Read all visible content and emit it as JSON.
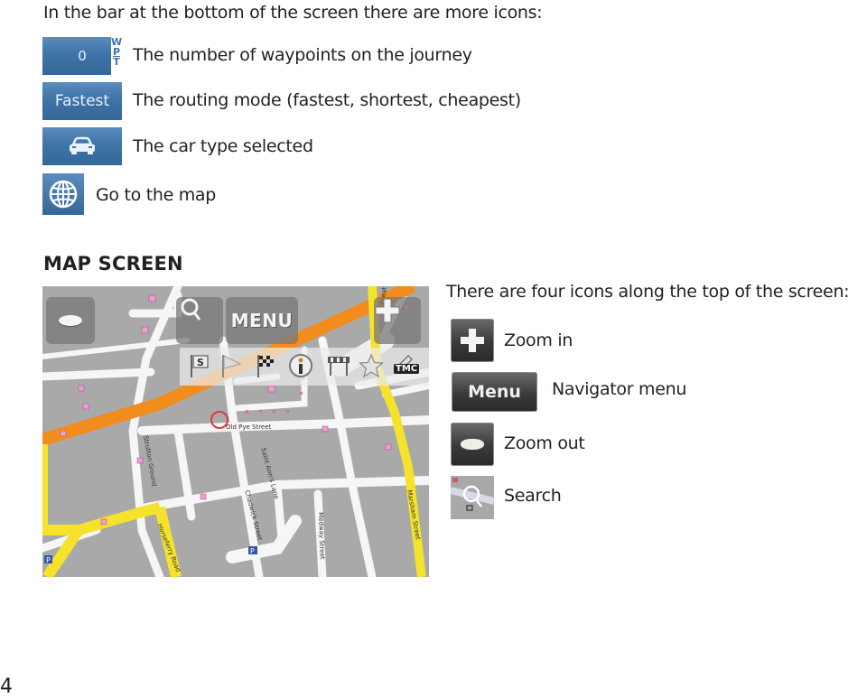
{
  "intro": "In the bar at the bottom of the screen there are more icons:",
  "bottom_bar_icons": [
    {
      "icon": "waypoint-count-icon",
      "label_on_icon": "0",
      "side_letters": [
        "W",
        "P",
        "T"
      ],
      "description": "The number of waypoints on the journey"
    },
    {
      "icon": "routing-mode-icon",
      "label_on_icon": "Fastest",
      "description": "The routing mode (fastest, shortest, cheapest)"
    },
    {
      "icon": "car-icon",
      "label_on_icon": "",
      "description": "The car type selected"
    },
    {
      "icon": "globe-icon",
      "label_on_icon": "",
      "description": "Go to the map"
    }
  ],
  "map_section": {
    "title": "MAP SCREEN",
    "map": {
      "menu_label": "MENU",
      "tmc_label": "TMC",
      "streets": [
        "Old Pye Street",
        "Saint Ann's Lane",
        "Chadwick Street",
        "Great Smith Street",
        "Horseferry Road",
        "Marsham Street",
        "Medway Street",
        "Strutton Ground"
      ],
      "toolbar_icons": [
        "start-flag-icon",
        "waypoint-flag-icon",
        "finish-flag-icon",
        "info-icon",
        "roadworks-icon",
        "favourite-star-icon",
        "edit-pencil-icon"
      ]
    },
    "intro": "There are four icons along the top of the screen:",
    "top_icons": [
      {
        "icon": "zoom-in-icon",
        "label_on_icon": "",
        "description": "Zoom in"
      },
      {
        "icon": "menu-icon",
        "label_on_icon": "Menu",
        "description": "Navigator menu"
      },
      {
        "icon": "zoom-out-icon",
        "label_on_icon": "",
        "description": "Zoom out"
      },
      {
        "icon": "search-icon",
        "label_on_icon": "",
        "description": "Search"
      }
    ]
  },
  "page_number": "4",
  "colors": {
    "icon_blue": "#3f74a8",
    "map_gray": "#a9a9a9",
    "main_road_orange": "#f28c1c",
    "secondary_road_yellow": "#f5e22b",
    "marker_red": "#e0393a"
  }
}
